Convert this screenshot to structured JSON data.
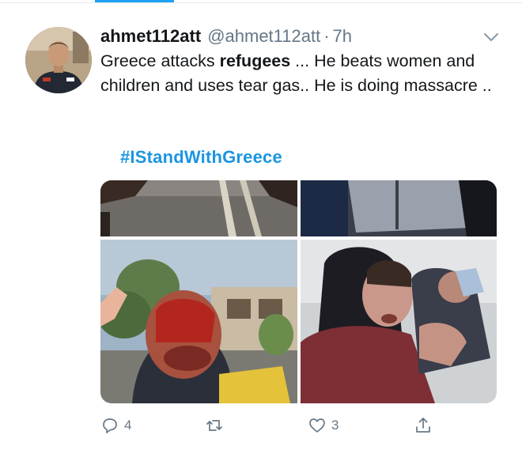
{
  "tweet": {
    "name": "ahmet112att",
    "handle": "@ahmet112att",
    "separator": "·",
    "time": "7h",
    "text_part1": "Greece attacks ",
    "text_bold": "refugees",
    "text_part2": " ... He beats women and children and uses tear gas.. He is doing massacre ..",
    "hashtag": "#IStandWithGreece"
  },
  "actions": {
    "reply_count": "4",
    "retweet_count": "",
    "like_count": "3"
  },
  "colors": {
    "accent": "#1da1f2",
    "hashtag": "#1b95e0",
    "muted": "#657786"
  },
  "icons": [
    "caret-down-icon",
    "reply-icon",
    "retweet-icon",
    "like-icon",
    "share-icon"
  ]
}
